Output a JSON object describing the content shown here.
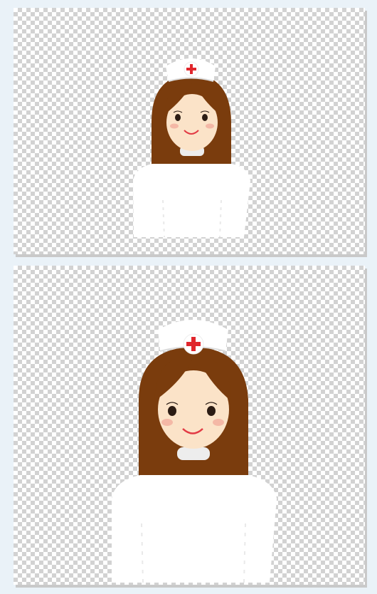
{
  "canvas": {
    "background": "#eaf2f8",
    "checker_light": "#ffffff",
    "checker_dark": "#d2d2d2"
  },
  "colors": {
    "hair": "#7a3c0d",
    "skin": "#fbe3c8",
    "blush": "#f4b8a6",
    "uniform": "#ffffff",
    "uniform_shade": "#e9e9e9",
    "cap": "#ffffff",
    "cross": "#e0262c",
    "mouth": "#e23a44",
    "eye": "#2b1c14"
  },
  "panels": [
    {
      "id": "panel-top",
      "content": "nurse-illustration",
      "variant": "small"
    },
    {
      "id": "panel-bottom",
      "content": "nurse-illustration",
      "variant": "large"
    }
  ]
}
